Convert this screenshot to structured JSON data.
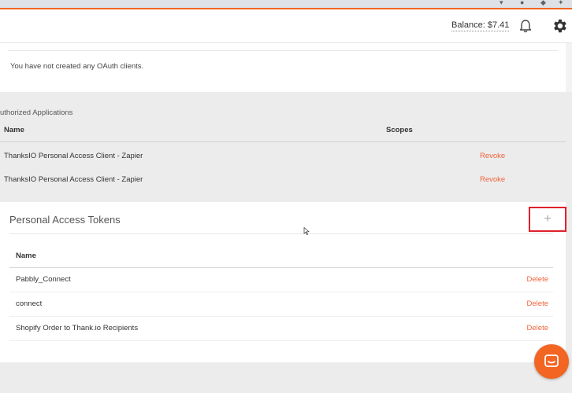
{
  "header": {
    "balance": "Balance: $7.41",
    "icons": [
      "bell-icon",
      "gear-icon"
    ]
  },
  "oauth_clients": {
    "empty_message": "You have not created any OAuth clients."
  },
  "authorized_apps": {
    "title": "uthorized Applications",
    "columns": [
      "Name",
      "Scopes"
    ],
    "rows": [
      {
        "name": "ThanksIO Personal Access Client - Zapier",
        "action": "Revoke"
      },
      {
        "name": "ThanksIO Personal Access Client - Zapier",
        "action": "Revoke"
      }
    ]
  },
  "tokens": {
    "title": "Personal Access Tokens",
    "add_label": "+",
    "column": "Name",
    "rows": [
      {
        "name": "Pabbly_Connect",
        "action": "Delete"
      },
      {
        "name": "connect",
        "action": "Delete"
      },
      {
        "name": "Shopify Order to Thank.io Recipients",
        "action": "Delete"
      }
    ]
  },
  "colors": {
    "accent": "#f26522",
    "link": "#f0643c",
    "highlight": "#e0202c"
  }
}
